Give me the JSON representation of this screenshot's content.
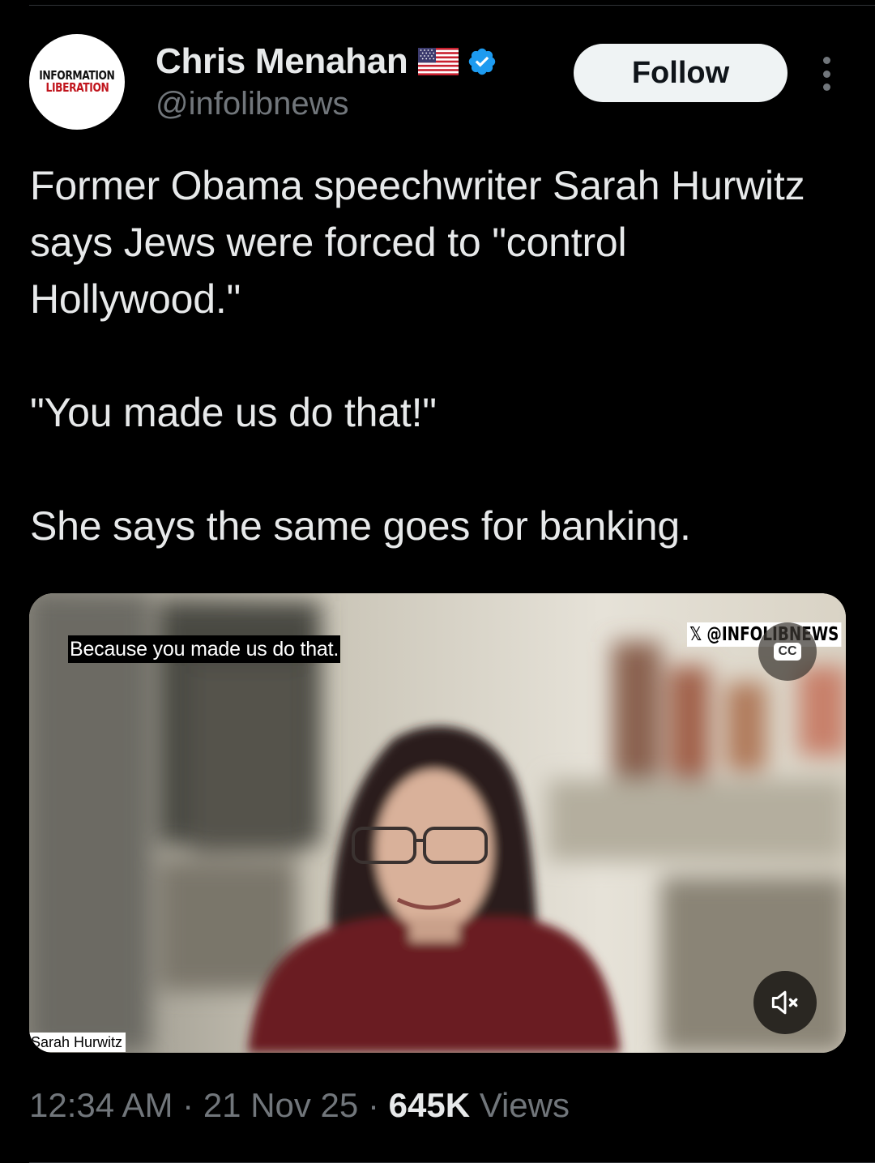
{
  "author": {
    "avatar_text_line1": "INFORMATION",
    "avatar_text_line2": "LIBERATION",
    "name": "Chris Menahan",
    "handle": "@infolibnews",
    "flag_icon": "us-flag-icon",
    "verified_icon": "verified-badge-icon",
    "verified_color": "#1d9bf0"
  },
  "header": {
    "follow_label": "Follow",
    "more_icon": "more-vertical-icon"
  },
  "tweet": {
    "paragraphs": [
      "Former Obama speechwriter Sarah Hurwitz says Jews were forced to \"control Hollywood.\"",
      "\"You made us do that!\"",
      "She says the same goes for banking."
    ]
  },
  "video": {
    "subtitle": "Because you made us do that.",
    "watermark": "𝕏 @INFOLIBNEWS",
    "cc_label": "CC",
    "mute_icon": "volume-muted-icon",
    "nameplate": "Sarah Hurwitz"
  },
  "meta": {
    "time": "12:34 AM",
    "separator": "·",
    "date": "21 Nov 25",
    "views_count": "645K",
    "views_label": "Views"
  },
  "colors": {
    "background": "#000000",
    "text_primary": "#e7e9ea",
    "text_secondary": "#71767b",
    "follow_bg": "#eff3f4"
  }
}
